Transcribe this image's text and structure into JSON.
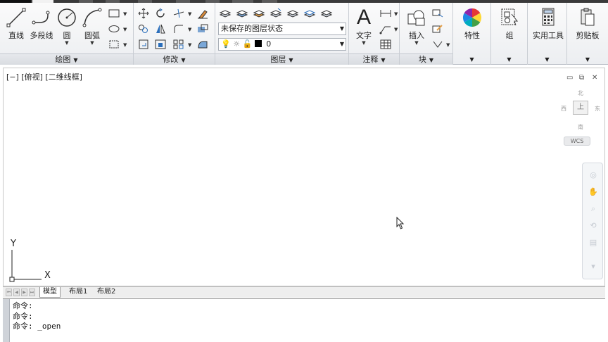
{
  "ribbon": {
    "draw_panel": {
      "title": "绘图",
      "line_label": "直线",
      "polyline_label": "多段线",
      "circle_label": "圆",
      "arc_label": "圆弧"
    },
    "modify_panel": {
      "title": "修改"
    },
    "layers_panel": {
      "title": "图层",
      "layer_state": "未保存的图层状态",
      "current_layer": "0",
      "layer_color": "#000000"
    },
    "annotation_panel": {
      "title": "注释",
      "text_label": "文字"
    },
    "block_panel": {
      "title": "块",
      "insert_label": "插入"
    },
    "properties_label": "特性",
    "group_label": "组",
    "utilities_label": "实用工具",
    "clipboard_label": "剪贴板"
  },
  "viewport": {
    "label": "[−] [俯视] [二维线框]",
    "viewcube": {
      "north": "北",
      "south": "南",
      "east": "东",
      "west": "西",
      "top": "上"
    },
    "wcs_label": "WCS",
    "ucs_x": "X",
    "ucs_y": "Y",
    "window_controls": {
      "minimize": "▭",
      "restore": "⧉",
      "close": "✕"
    }
  },
  "layout_tabs": [
    "模型",
    "布局1",
    "布局2"
  ],
  "command_line": [
    "命令:",
    "命令:",
    "命令: _open"
  ],
  "colors": {
    "accent": "#2a6ebb",
    "ribbon_bg": "#eceef1"
  }
}
